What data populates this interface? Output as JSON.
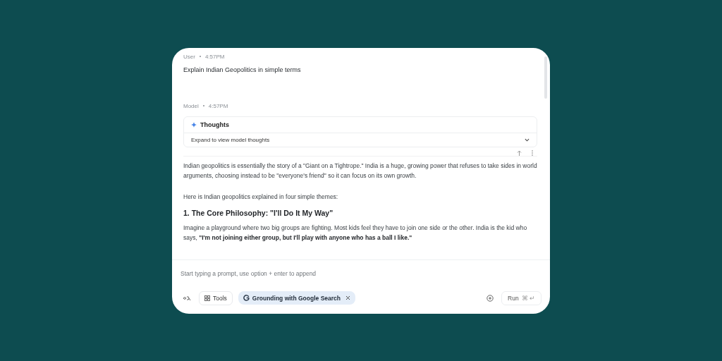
{
  "messages": [
    {
      "role": "User",
      "time": "4:57PM",
      "text": "Explain Indian Geopolitics in simple terms"
    },
    {
      "role": "Model",
      "time": "4:57PM"
    }
  ],
  "thoughts": {
    "title": "Thoughts",
    "summary": "Expand to view model thoughts",
    "expanded": false
  },
  "response": {
    "intro": "Indian geopolitics is essentially the story of a \"Giant on a Tightrope.\" India is a huge, growing power that refuses to take sides in world arguments, choosing instead to be \"everyone's friend\" so it can focus on its own growth.",
    "lead": "Here is Indian geopolitics explained in four simple themes:",
    "heading": "1. The Core Philosophy: \"I'll Do It My Way\"",
    "body": "Imagine a playground where two big groups are fighting. Most kids feel they have to join one side or the other. India is the kid who says, **\"I'm not joining either group, but I'll play with anyone who has a ball I like.\"**"
  },
  "composer": {
    "placeholder": "Start typing a prompt, use option + enter to append",
    "tools_label": "Tools",
    "chip": "Grounding with Google Search",
    "run_label": "Run",
    "run_keys": "⌘ ↵"
  }
}
